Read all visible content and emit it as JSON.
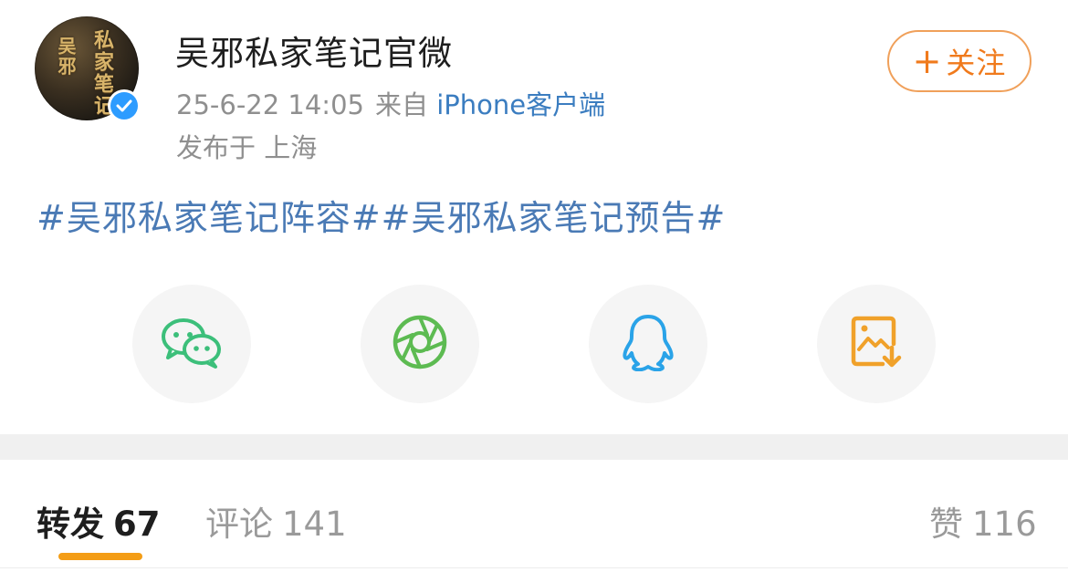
{
  "account": {
    "name": "吴邪私家笔记官微",
    "avatar_text_1": "吴邪",
    "avatar_text_2": "私家笔记",
    "time": "25-6-22 14:05",
    "from_label": "来自",
    "source": "iPhone客户端",
    "location": "发布于 上海"
  },
  "follow_button": {
    "label": "关注",
    "icon": "plus-icon"
  },
  "post": {
    "topics_text": "#吴邪私家笔记阵容##吴邪私家笔记预告#"
  },
  "share": {
    "items": [
      {
        "icon": "wechat-icon",
        "color": "#3cbf7a"
      },
      {
        "icon": "moments-icon",
        "color": "#5dbb52"
      },
      {
        "icon": "qq-icon",
        "color": "#2aa3e8"
      },
      {
        "icon": "save-image-icon",
        "color": "#f0a12a"
      }
    ]
  },
  "tabs": {
    "repost": {
      "label": "转发",
      "count": "67"
    },
    "comment": {
      "label": "评论",
      "count": "141"
    },
    "like": {
      "label": "赞",
      "count": "116"
    }
  },
  "colors": {
    "link": "#4a7ab5",
    "accent_orange": "#f49d16",
    "verify_blue": "#2d9cff"
  }
}
